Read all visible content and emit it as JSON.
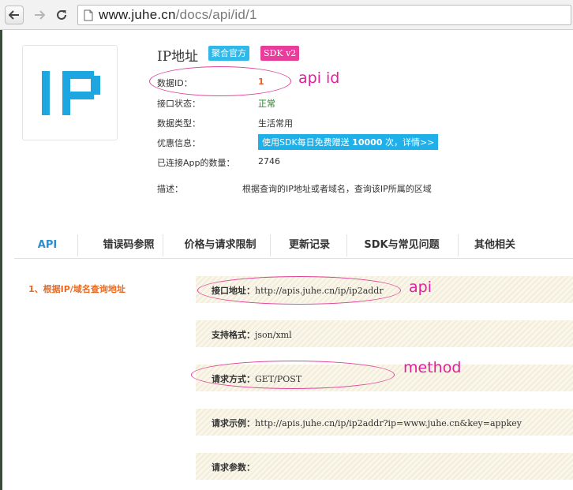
{
  "browser": {
    "url_host": "www.juhe.cn",
    "url_path": "/docs/api/id/1"
  },
  "api": {
    "title": "IP地址",
    "tag_official": "聚合官方",
    "tag_sdk": "SDK v2",
    "info": [
      {
        "label": "数据ID：",
        "value": "1"
      },
      {
        "label": "接口状态：",
        "value": "正常"
      },
      {
        "label": "数据类型：",
        "value": "生活常用"
      },
      {
        "label": "优惠信息：",
        "value_prefix": "使用SDK每日免费赠送 ",
        "value_bold": "10000",
        "value_suffix": " 次，详情>>"
      },
      {
        "label": "已连接App的数量：",
        "value": "2746"
      },
      {
        "label": "描述：",
        "value": "根据查询的IP地址或者域名，查询该IP所属的区域"
      }
    ]
  },
  "annotations": {
    "api_id": "api id",
    "api": "api",
    "method": "method"
  },
  "tabs": [
    "API",
    "错误码参照",
    "价格与请求限制",
    "更新记录",
    "SDK与常见问题",
    "其他相关"
  ],
  "active_tab": "API",
  "side": {
    "link": "1、根据IP/域名查询地址"
  },
  "spec": [
    {
      "label": "接口地址：",
      "value": "http://apis.juhe.cn/ip/ip2addr"
    },
    {
      "label": "支持格式：",
      "value": "json/xml"
    },
    {
      "label": "请求方式：",
      "value": "GET/POST"
    },
    {
      "label": "请求示例：",
      "value": "http://apis.juhe.cn/ip/ip2addr?ip=www.juhe.cn&key=appkey"
    },
    {
      "label": "请求参数：",
      "value": ""
    }
  ],
  "colors": {
    "accent_blue": "#2fb8e8",
    "sdk_pink": "#e83d9a",
    "annotation": "#e0209a",
    "status_green": "#1a8a1a",
    "side_link_orange": "#e86a20"
  },
  "icons": [
    "back-arrow-icon",
    "forward-arrow-icon",
    "reload-icon",
    "page-icon",
    "ip-logo-icon"
  ]
}
